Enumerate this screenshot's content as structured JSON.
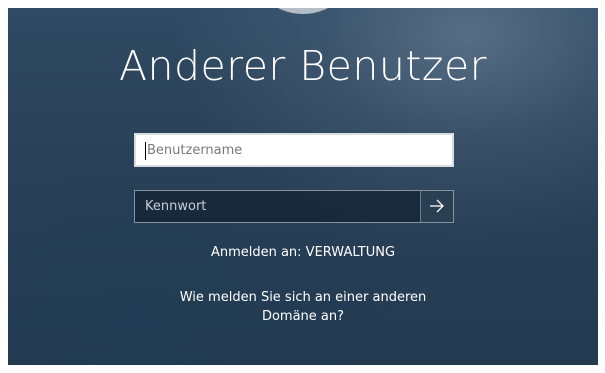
{
  "title": "Anderer Benutzer",
  "username": {
    "placeholder": "Benutzername",
    "value": ""
  },
  "password": {
    "placeholder": "Kennwort",
    "value": ""
  },
  "submit": {
    "icon": "arrow-right-icon"
  },
  "sign_in_to": "Anmelden an: VERWALTUNG",
  "other_domain_link": "Wie melden Sie sich an einer anderen Domäne an?",
  "colors": {
    "background": "#2a4259",
    "text": "#ffffff",
    "input_border": "#8793a0"
  }
}
